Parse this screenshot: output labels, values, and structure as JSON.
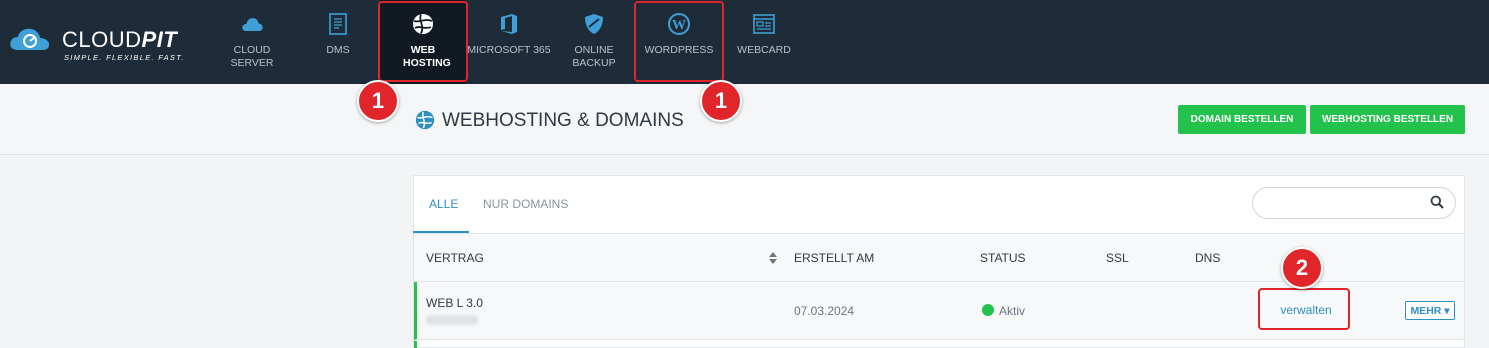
{
  "brand": {
    "name_light": "CLOUD",
    "name_bold": "PIT",
    "tagline": "SIMPLE. FLEXIBLE. FAST."
  },
  "nav": {
    "items": [
      {
        "label": "CLOUD SERVER",
        "icon": "cloud-icon"
      },
      {
        "label": "DMS",
        "icon": "document-icon"
      },
      {
        "label": "WEB HOSTING",
        "icon": "globe-icon",
        "active": true
      },
      {
        "label": "MICROSOFT 365",
        "icon": "office-icon"
      },
      {
        "label": "ONLINE BACKUP",
        "icon": "shield-icon"
      },
      {
        "label": "WORDPRESS",
        "icon": "wordpress-icon"
      },
      {
        "label": "WEBCARD",
        "icon": "webcard-icon"
      }
    ]
  },
  "annotations": {
    "badge_1": "1",
    "badge_2": "2",
    "highlight_color": "#e0262a"
  },
  "page": {
    "title": "WEBHOSTING & DOMAINS",
    "btn_domain": "DOMAIN BESTELLEN",
    "btn_webhosting": "WEBHOSTING BESTELLEN"
  },
  "tabs": {
    "all": "ALLE",
    "domains": "NUR DOMAINS"
  },
  "search": {
    "placeholder": "",
    "value": ""
  },
  "table": {
    "headers": {
      "vertrag": "VERTRAG",
      "erstellt": "ERSTELLT AM",
      "status": "STATUS",
      "ssl": "SSL",
      "dns": "DNS"
    },
    "rows": [
      {
        "vertrag": "WEB L 3.0",
        "erstellt": "07.03.2024",
        "status": "Aktiv",
        "action": "verwalten",
        "more": "MEHR"
      }
    ]
  },
  "colors": {
    "nav_bg": "#1e2b38",
    "accent_green": "#22c24c",
    "accent_blue": "#2e8fc4"
  }
}
